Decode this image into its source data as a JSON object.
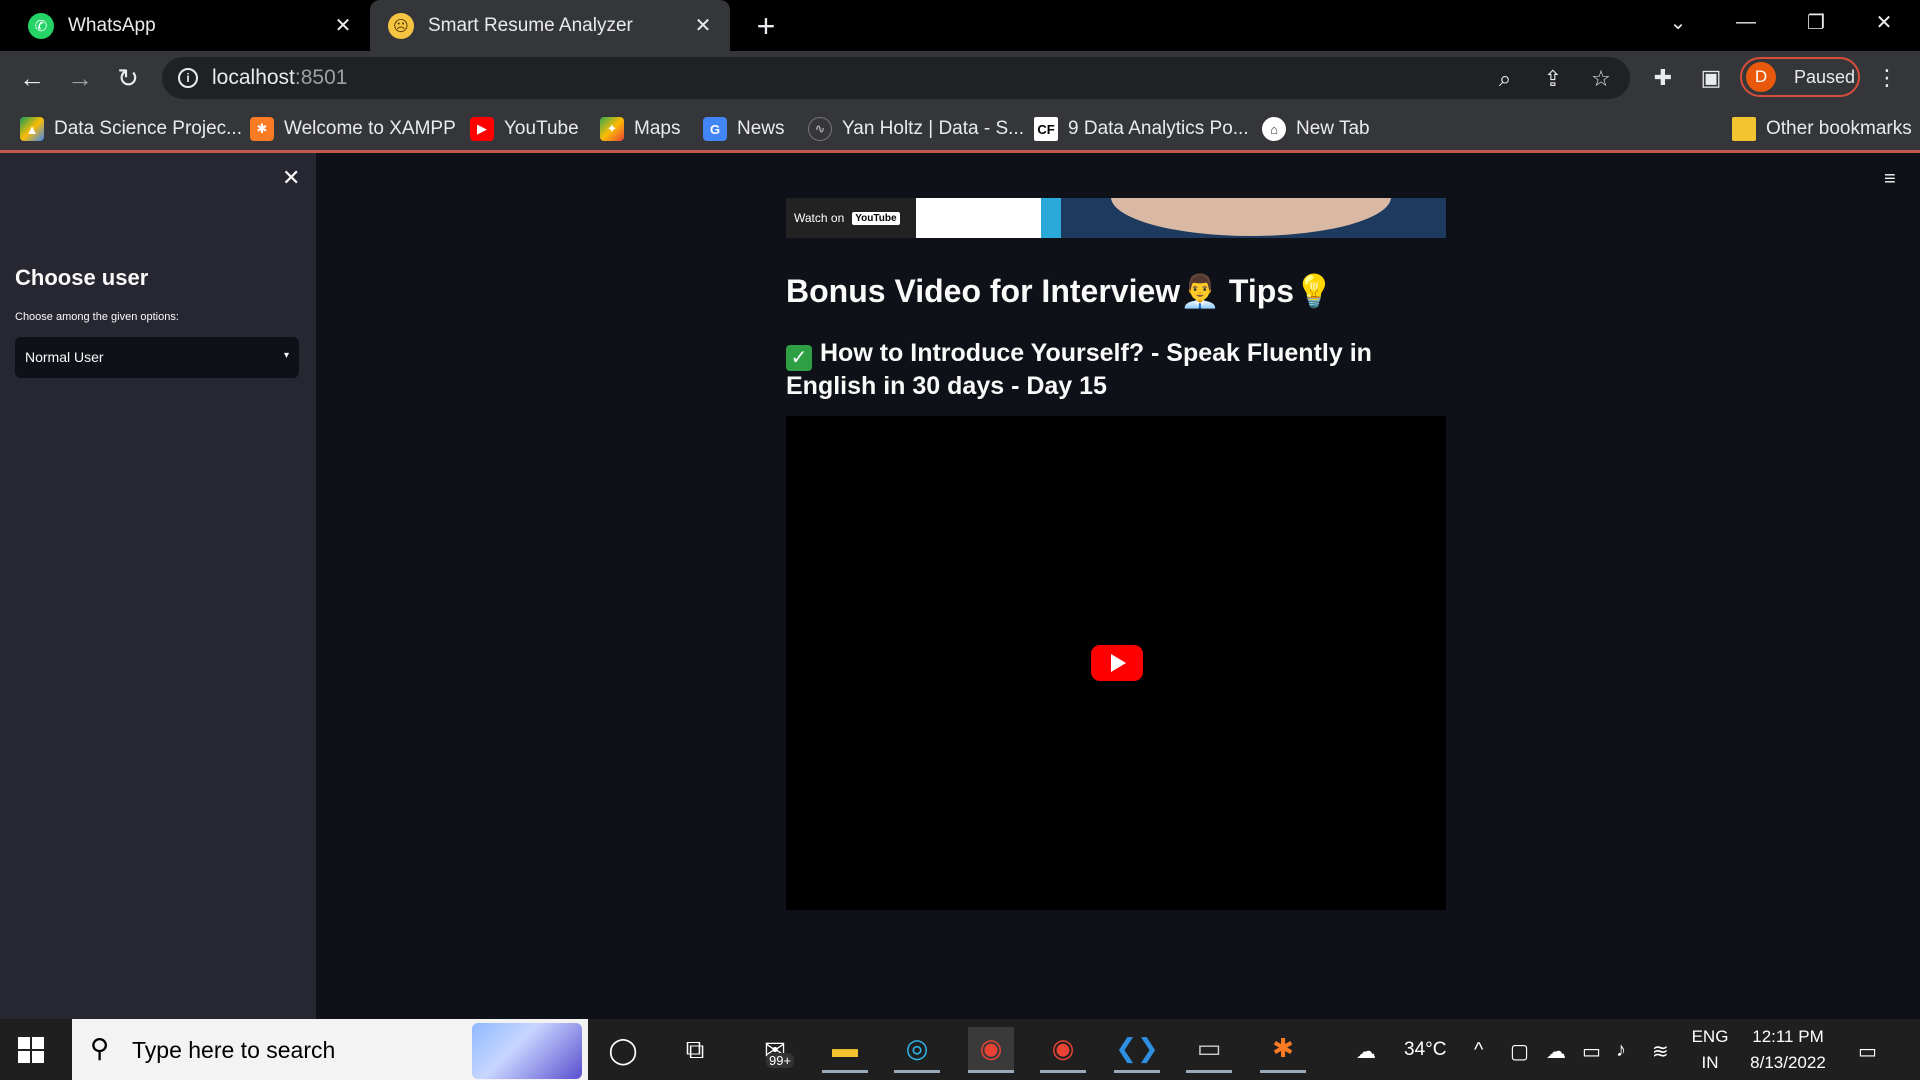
{
  "browser": {
    "tabs": [
      {
        "title": "WhatsApp",
        "favicon": "whatsapp-icon",
        "color": "#25d366"
      },
      {
        "title": "Smart Resume Analyzer",
        "favicon": "confused-face-icon",
        "color": "#f5c542"
      }
    ],
    "url_host": "localhost",
    "url_port": ":8501",
    "profile_initial": "D",
    "profile_status": "Paused"
  },
  "bookmarks": [
    {
      "label": "Data Science Projec...",
      "icon": "google-drive-icon"
    },
    {
      "label": "Welcome to XAMPP",
      "icon": "xampp-icon"
    },
    {
      "label": "YouTube",
      "icon": "youtube-icon"
    },
    {
      "label": "Maps",
      "icon": "maps-icon"
    },
    {
      "label": "News",
      "icon": "news-icon"
    },
    {
      "label": "Yan Holtz | Data - S...",
      "icon": "site-icon"
    },
    {
      "label": "9 Data Analytics Po...",
      "icon": "cf-icon"
    },
    {
      "label": "New Tab",
      "icon": "home-icon"
    },
    {
      "label": "Other bookmarks",
      "icon": "folder-icon"
    }
  ],
  "sidebar": {
    "title": "Choose user",
    "hint": "Choose among the given options:",
    "selected": "Normal User"
  },
  "main": {
    "watch_on": "Watch on",
    "youtube_badge": "YouTube",
    "heading": "Bonus Video for Interview👨‍💼 Tips💡",
    "subheading": "How to Introduce Yourself? - Speak Fluently in English in 30 days - Day 15"
  },
  "taskbar": {
    "search_placeholder": "Type here to search",
    "mail_badge": "99+",
    "temperature": "34°C",
    "lang_top": "ENG",
    "lang_bottom": "IN",
    "time": "12:11 PM",
    "date": "8/13/2022"
  }
}
